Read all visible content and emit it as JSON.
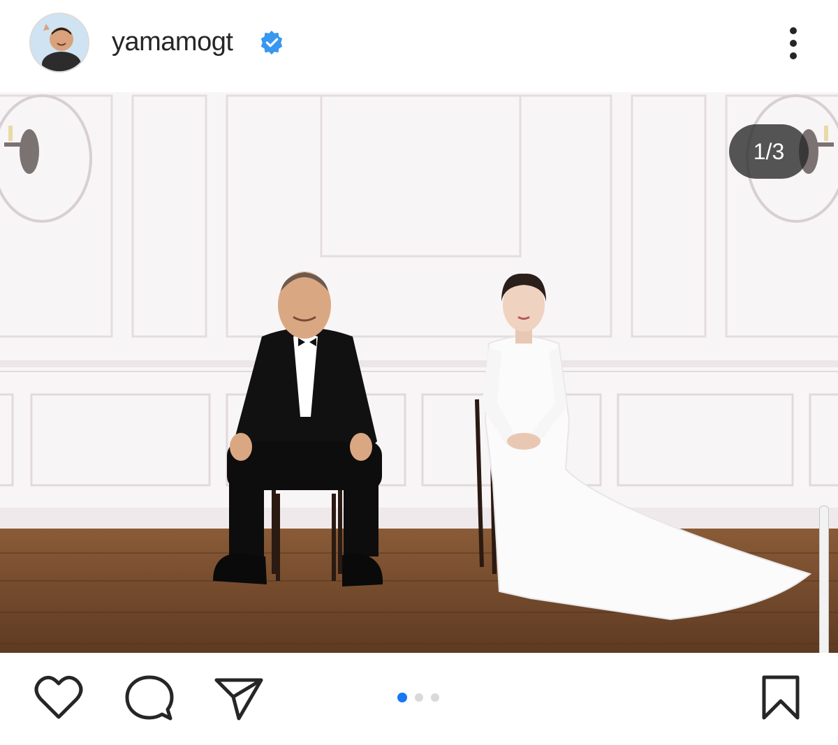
{
  "post": {
    "username": "yamamogt",
    "verified": true,
    "counter": "1/3",
    "carousel": {
      "total": 3,
      "active_index": 0
    }
  },
  "icons": {
    "verified": "verified-badge-icon",
    "more": "more-vertical-icon",
    "like": "heart-icon",
    "comment": "comment-bubble-icon",
    "share": "paper-plane-icon",
    "save": "bookmark-icon"
  },
  "colors": {
    "active_dot": "#1877f2",
    "inactive_dot": "#d9d9d9",
    "verified_badge": "#3897f0",
    "text": "#262626"
  }
}
